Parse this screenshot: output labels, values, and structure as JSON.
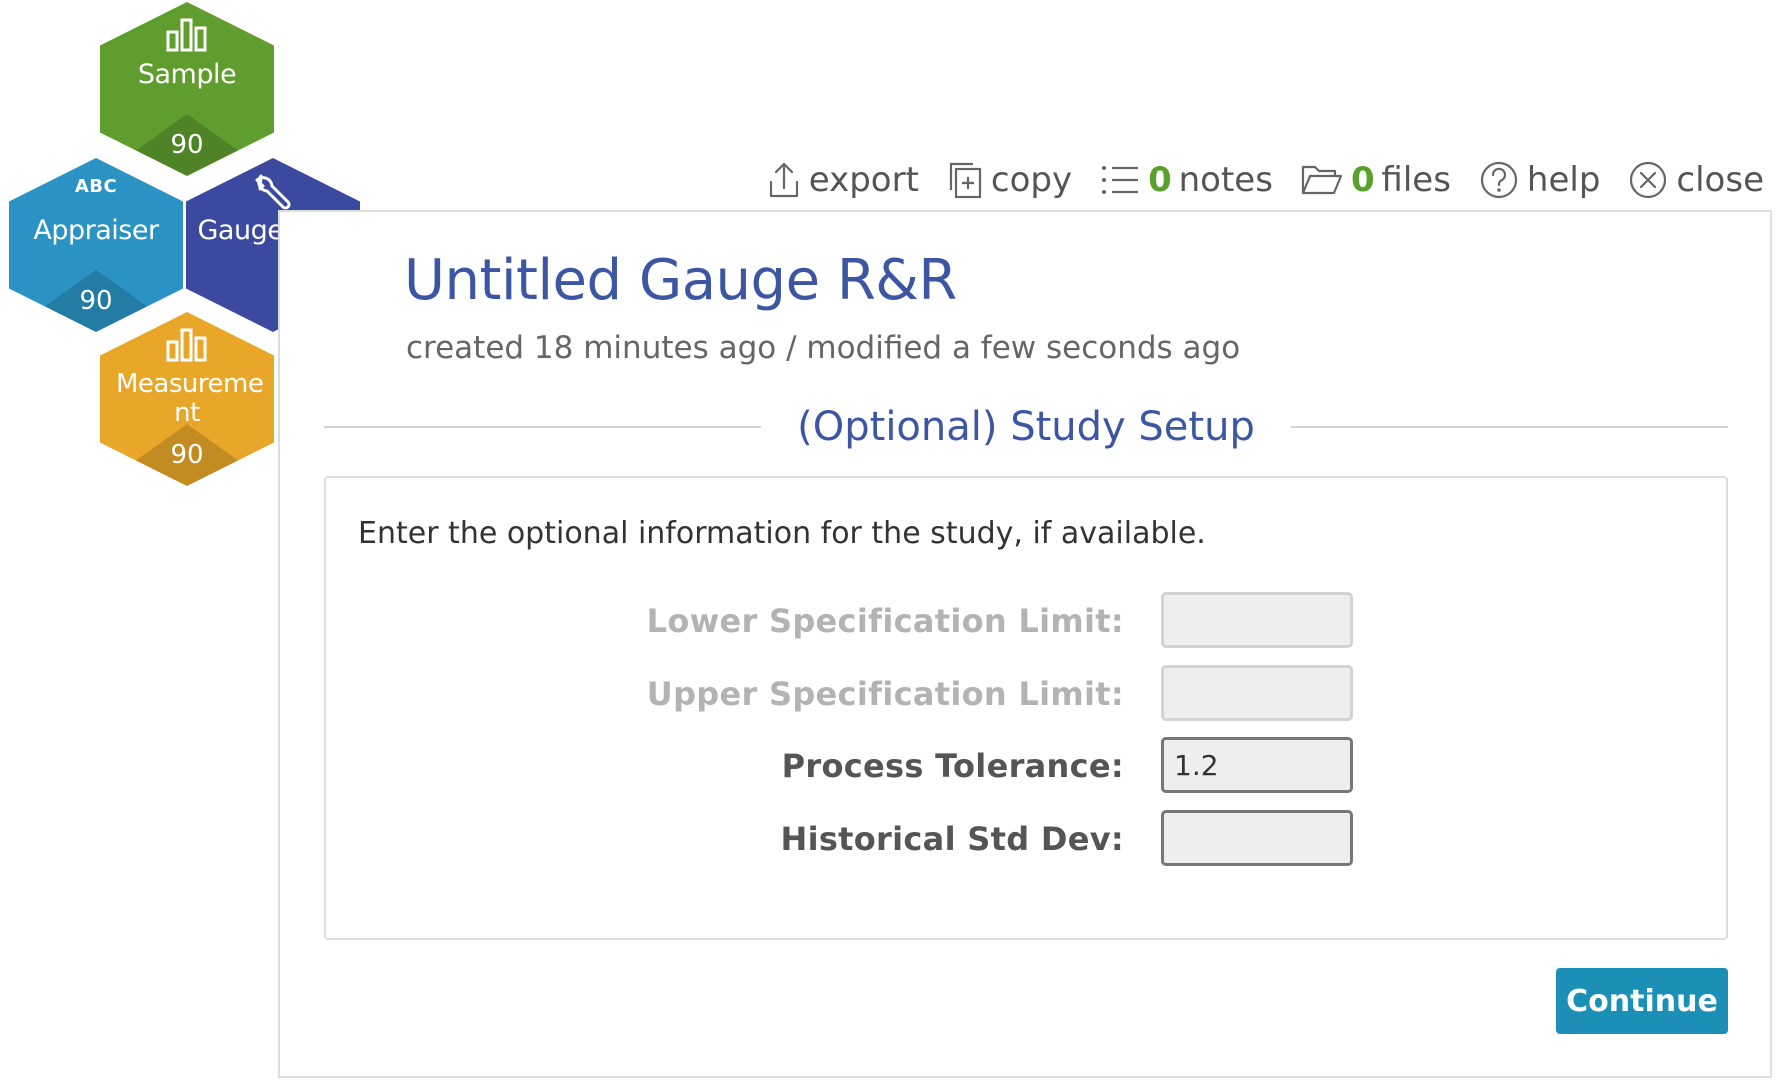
{
  "nav": {
    "sample": {
      "label": "Sample",
      "count": "90",
      "icon": "bar-chart-icon",
      "color": "#5f9e2e"
    },
    "appraiser": {
      "label": "Appraiser",
      "count": "90",
      "icon_text": "ABC",
      "color": "#2b93c4"
    },
    "gauge": {
      "label": "Gauge R&R",
      "icon": "wrench-icon",
      "color": "#3b4a9e"
    },
    "measurement": {
      "label": "Measureme nt",
      "count": "90",
      "icon": "bar-chart-icon",
      "color": "#e9a72a"
    }
  },
  "toolbar": {
    "export_label": "export",
    "copy_label": "copy",
    "notes_count": "0",
    "notes_label": "notes",
    "files_count": "0",
    "files_label": "files",
    "help_label": "help",
    "close_label": "close"
  },
  "document": {
    "title": "Untitled Gauge R&R",
    "meta": "created 18 minutes ago / modified a few seconds ago"
  },
  "setup": {
    "heading": "(Optional) Study Setup",
    "intro": "Enter the optional information for the study, if available.",
    "fields": [
      {
        "label": "Lower Specification Limit:",
        "value": "",
        "enabled": false
      },
      {
        "label": "Upper Specification Limit:",
        "value": "",
        "enabled": false
      },
      {
        "label": "Process Tolerance:",
        "value": "1.2",
        "enabled": true
      },
      {
        "label": "Historical Std Dev:",
        "value": "",
        "enabled": true
      }
    ],
    "continue_label": "Continue"
  },
  "colors": {
    "accent": "#3d56a3",
    "button": "#1b8fb5",
    "count_green": "#5aa02c"
  }
}
